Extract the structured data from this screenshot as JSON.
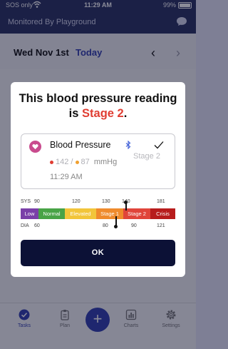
{
  "status_bar": {
    "carrier": "SOS only",
    "time": "11:29 AM",
    "battery": "99%",
    "battery_level": 0.99
  },
  "header": {
    "title": "Monitored By Playground",
    "chat_icon": "chat-bubble-icon"
  },
  "date_bar": {
    "date": "Wed Nov 1st",
    "today_label": "Today",
    "prev_icon": "chevron-left-icon",
    "next_icon": "chevron-right-icon"
  },
  "modal": {
    "title_prefix": "This blood pressure reading is",
    "stage_text": "Stage 2",
    "title_suffix": ".",
    "stage_color": "#e03d32",
    "card": {
      "label": "Blood Pressure",
      "systolic": "142",
      "separator": "/",
      "diastolic": "87",
      "unit": "mmHg",
      "time": "11:29 AM",
      "faded_stage": "Stage 2",
      "icons": [
        "heart-icon",
        "bluetooth-icon",
        "checkmark-icon"
      ]
    },
    "scale": {
      "sys_label": "SYS",
      "dia_label": "DIA",
      "sys_ticks": [
        "90",
        "120",
        "130",
        "140",
        "181"
      ],
      "dia_ticks": [
        "60",
        "80",
        "90",
        "121"
      ],
      "segments": [
        {
          "label": "Low",
          "color": "#7a3fa8"
        },
        {
          "label": "Normal",
          "color": "#48a346"
        },
        {
          "label": "Elevated",
          "color": "#f2c53a"
        },
        {
          "label": "Stage 1",
          "color": "#ef8b2c"
        },
        {
          "label": "Stage 2",
          "color": "#e0453a"
        },
        {
          "label": "Crisis",
          "color": "#b71c1c"
        }
      ],
      "marker_systolic": 142,
      "marker_diastolic": 87
    },
    "ok_label": "OK"
  },
  "tabs": [
    {
      "label": "Tasks",
      "icon": "checkmark-circle-icon",
      "active": true
    },
    {
      "label": "Plan",
      "icon": "clipboard-icon",
      "active": false
    },
    {
      "label": "",
      "icon": "plus-icon",
      "active": false
    },
    {
      "label": "Charts",
      "icon": "bar-chart-icon",
      "active": false
    },
    {
      "label": "Settings",
      "icon": "gear-icon",
      "active": false
    }
  ],
  "colors": {
    "brand": "#2b3263",
    "accent": "#3340b0",
    "button_dark": "#0c1136"
  }
}
